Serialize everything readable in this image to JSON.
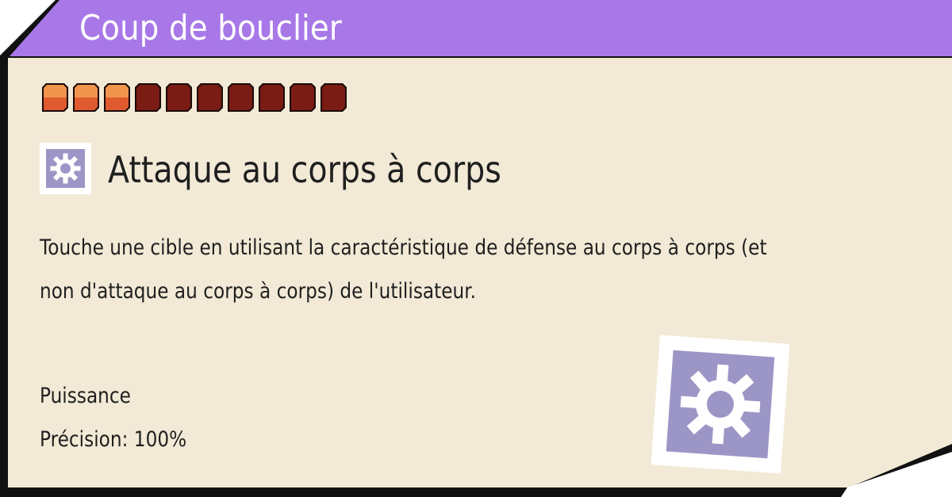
{
  "card": {
    "title": "Coup de bouclier",
    "category": "Attaque au corps à corps",
    "description_lines": [
      "Touche une cible en utilisant la caractéristique de défense au corps à corps (et",
      "non d'attaque au corps à corps) de l'utilisateur."
    ],
    "stats": {
      "power": "Puissance",
      "accuracy": "Précision: 100%"
    }
  },
  "pips": {
    "filled": 3,
    "total": 10
  },
  "colors": {
    "header": "#a878e8",
    "card_bg": "#f2ead6",
    "border": "#111111",
    "pip_filled_top": "#f0944e",
    "pip_filled_bottom": "#df5a2f",
    "pip_empty": "#7a1b14",
    "icon_fill": "#9c96c6"
  },
  "icons": {
    "category": "gear-icon",
    "large": "gear-icon"
  }
}
